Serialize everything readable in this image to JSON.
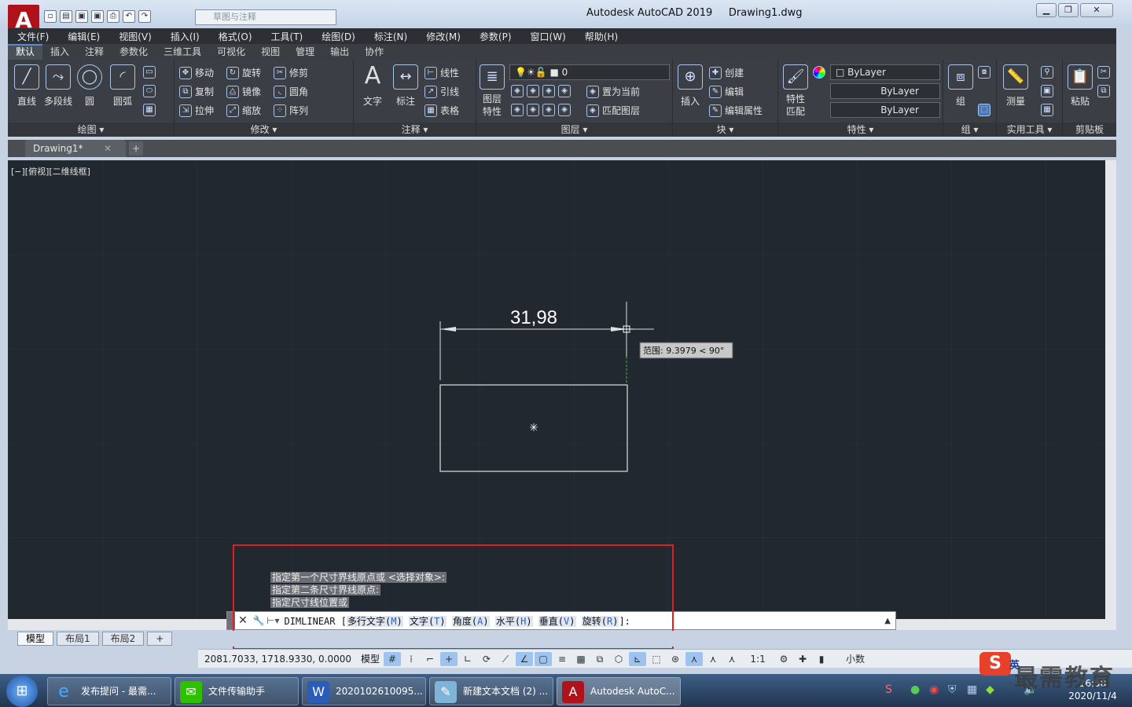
{
  "window": {
    "app_title": "Autodesk AutoCAD 2019",
    "file_name": "Drawing1.dwg",
    "workspace_placeholder": "草图与注释",
    "logo_letter": "A"
  },
  "menu": [
    "文件(F)",
    "编辑(E)",
    "视图(V)",
    "插入(I)",
    "格式(O)",
    "工具(T)",
    "绘图(D)",
    "标注(N)",
    "修改(M)",
    "参数(P)",
    "窗口(W)",
    "帮助(H)"
  ],
  "ribbon_tabs": [
    "默认",
    "插入",
    "注释",
    "参数化",
    "三维工具",
    "可视化",
    "视图",
    "管理",
    "输出",
    "协作"
  ],
  "ribbon": {
    "draw": {
      "title": "绘图 ▾",
      "line": "直线",
      "polyline": "多段线",
      "circle": "圆",
      "arc": "圆弧"
    },
    "modify": {
      "title": "修改 ▾",
      "move": "移动",
      "rotate": "旋转",
      "trim": "修剪",
      "copy": "复制",
      "mirror": "镜像",
      "fillet": "圆角",
      "stretch": "拉伸",
      "scale": "缩放",
      "array": "阵列"
    },
    "annotation": {
      "title": "注释 ▾",
      "text": "文字",
      "dimension": "标注",
      "linear": "线性",
      "leader": "引线",
      "table": "表格"
    },
    "layers": {
      "title": "图层 ▾",
      "layer_props": "图层\n特性",
      "current_layer": "0",
      "set_current": "置为当前",
      "match_layer": "匹配图层"
    },
    "block": {
      "title": "块 ▾",
      "insert": "插入",
      "create": "创建",
      "edit": "编辑",
      "edit_attr": "编辑属性"
    },
    "properties": {
      "title": "特性 ▾",
      "match": "特性\n匹配",
      "color": "ByLayer",
      "linetype": "ByLayer",
      "lineweight": "ByLayer"
    },
    "groups": {
      "title": "组 ▾",
      "group": "组"
    },
    "utilities": {
      "title": "实用工具 ▾",
      "measure": "测量"
    },
    "clipboard": {
      "title": "剪贴板",
      "paste": "粘贴"
    }
  },
  "doc_tab": "Drawing1*",
  "viewport_label": "[−][俯视][二维线框]",
  "drawing": {
    "dimension_text": "31,98",
    "tooltip": "范围: 9.3979 < 90°"
  },
  "command_history": [
    "指定第一个尺寸界线原点或 <选择对象>:",
    "指定第二条尺寸界线原点:",
    "指定尺寸线位置或"
  ],
  "command": {
    "name": "DIMLINEAR",
    "options": [
      {
        "label": "多行文字",
        "key": "M"
      },
      {
        "label": "文字",
        "key": "T"
      },
      {
        "label": "角度",
        "key": "A"
      },
      {
        "label": "水平",
        "key": "H"
      },
      {
        "label": "垂直",
        "key": "V"
      },
      {
        "label": "旋转",
        "key": "R"
      }
    ]
  },
  "layout_tabs": [
    "模型",
    "布局1",
    "布局2",
    "+"
  ],
  "status": {
    "coords": "2081.7033, 1718.9330, 0.0000",
    "model": "模型",
    "scale": "1:1",
    "units": "小数"
  },
  "taskbar": {
    "items": [
      "发布提问 - 最需...",
      "文件传输助手",
      "2020102610095...",
      "新建文本文档 (2) ...",
      "Autodesk AutoC..."
    ],
    "time": "16:58",
    "date": "2020/11/4",
    "ime": "英"
  },
  "watermark": "最需教育",
  "colors": {
    "canvas": "#212830",
    "ribbon": "#3b3f45",
    "highlight_box": "#e02020",
    "autocad_red": "#b0121c"
  }
}
